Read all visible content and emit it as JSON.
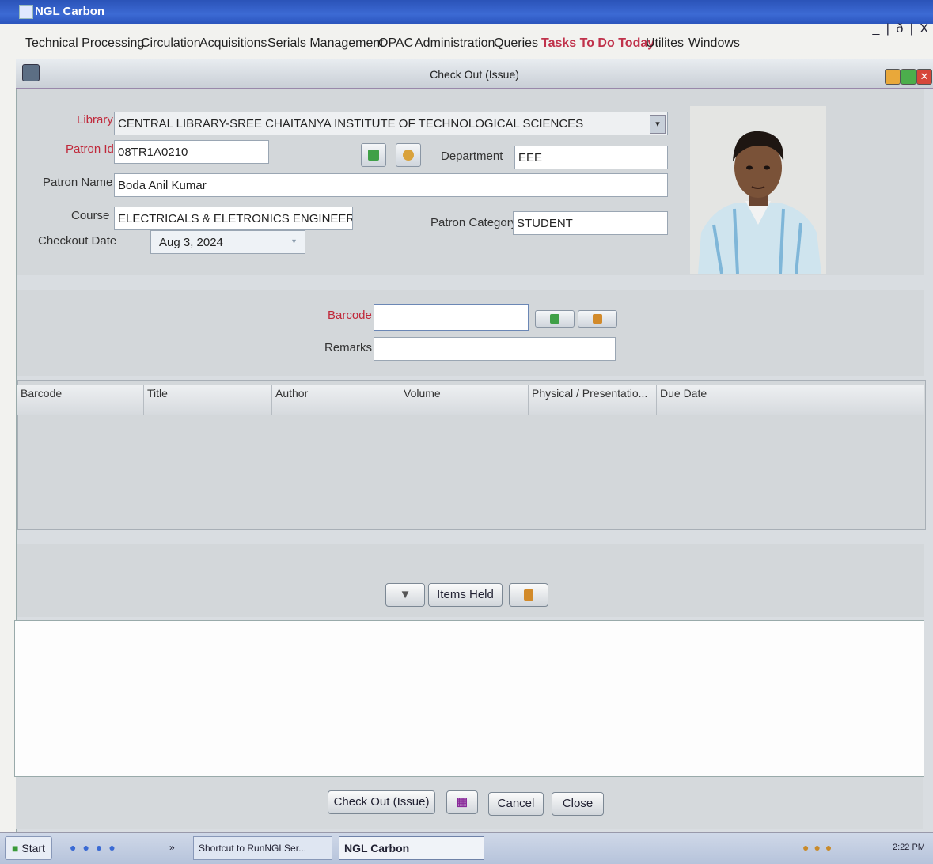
{
  "app": {
    "title": "NGL Carbon",
    "window_controls": "_ | ð | X"
  },
  "menu": [
    "Technical Processing",
    "Circulation",
    "Acquisitions",
    "Serials Management",
    "OPAC",
    "Administration",
    "Queries",
    "Tasks To Do Today",
    "Utilites",
    "Windows"
  ],
  "frame": {
    "title": "Check Out (Issue)"
  },
  "patron": {
    "library_label": "Library",
    "library_value": "CENTRAL LIBRARY-SREE CHAITANYA INSTITUTE OF TECHNOLOGICAL SCIENCES",
    "patron_id_label": "Patron Id",
    "patron_id_value": "08TR1A0210",
    "department_label": "Department",
    "department_value": "EEE",
    "patron_name_label": "Patron Name",
    "patron_name_value": "Boda Anil Kumar",
    "course_label": "Course",
    "course_value": "ELECTRICALS & ELETRONICS ENGINEERING",
    "category_label": "Patron Category",
    "category_value": "STUDENT",
    "checkout_date_label": "Checkout Date",
    "checkout_date_value": "Aug 3, 2024"
  },
  "issue": {
    "barcode_label": "Barcode",
    "barcode_value": "",
    "remarks_label": "Remarks",
    "remarks_value": ""
  },
  "table": {
    "columns": [
      "Barcode",
      "Title",
      "Author",
      "Volume",
      "Physical / Presentatio...",
      "Due Date"
    ],
    "rows": []
  },
  "items_held": {
    "label": "Items Held"
  },
  "actions": {
    "checkout": "Check Out (Issue)",
    "cancel": "Cancel",
    "close": "Close"
  },
  "taskbar": {
    "start": "Start",
    "chevron": "»",
    "task1": "Shortcut to RunNGLSer...",
    "task2": "NGL Carbon",
    "clock": "2:22 PM"
  },
  "colors": {
    "title_bar": "#2b55bd",
    "required_label": "#c0283a",
    "menu_highlight": "#c0324b"
  }
}
